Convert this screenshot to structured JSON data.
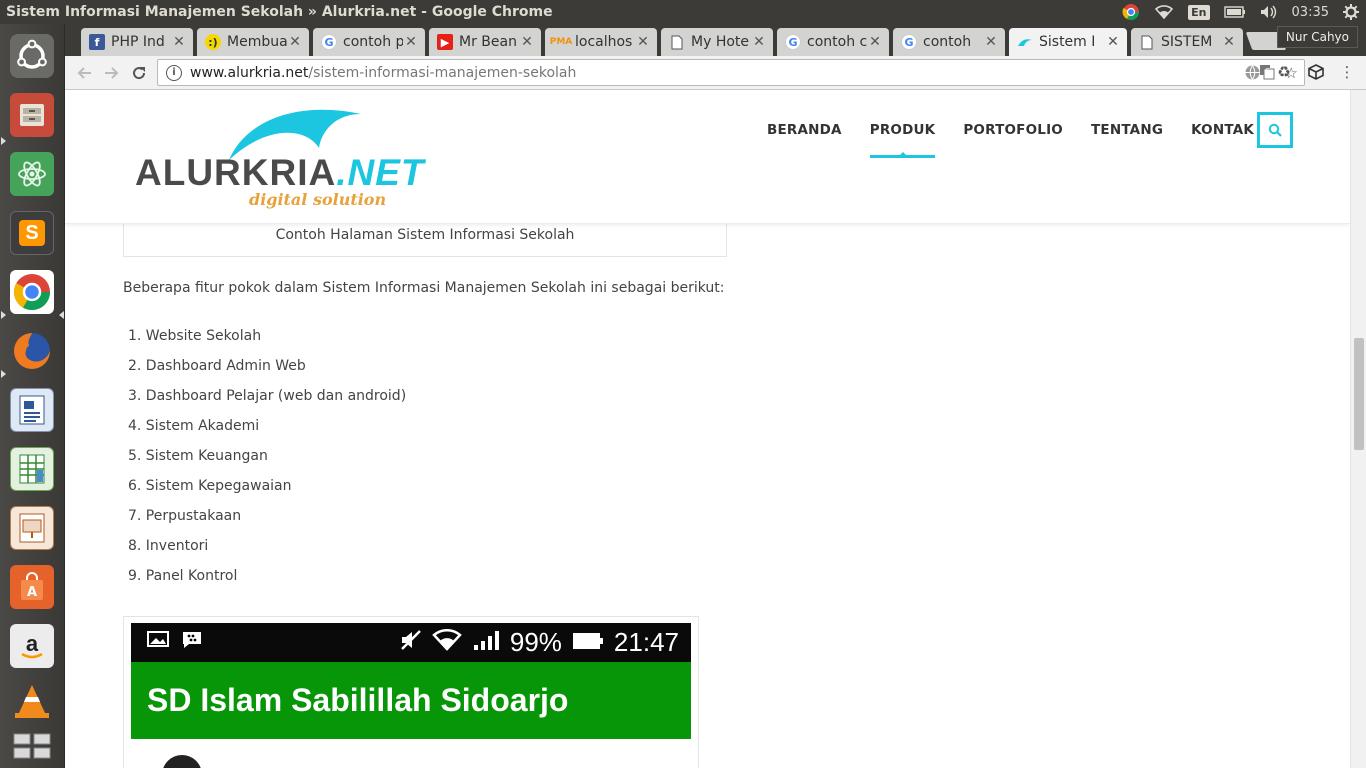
{
  "window": {
    "title": "Sistem Informasi Manajemen Sekolah » Alurkria.net - Google Chrome"
  },
  "tray": {
    "lang": "En",
    "clock": "03:35"
  },
  "launcher": {
    "items": [
      "ubuntu-dash",
      "files",
      "atom",
      "sublime-text",
      "chrome",
      "firefox",
      "libreoffice-writer",
      "libreoffice-calc",
      "libreoffice-impress",
      "software-center",
      "amazon",
      "vlc",
      "workspace-switcher"
    ]
  },
  "tabs": [
    {
      "label": "PHP Ind",
      "icon": "facebook-icon",
      "color": "#3b5998"
    },
    {
      "label": "Membua",
      "icon": "emoji-icon",
      "color": "#f5d800"
    },
    {
      "label": "contoh p",
      "icon": "google-icon",
      "color": "#4285f4"
    },
    {
      "label": "Mr Bean",
      "icon": "youtube-icon",
      "color": "#e62117"
    },
    {
      "label": "localhos",
      "icon": "phpmyadmin-icon",
      "color": "#f29111"
    },
    {
      "label": "My Hote",
      "icon": "page-icon",
      "color": "#888888"
    },
    {
      "label": "contoh c",
      "icon": "google-icon",
      "color": "#4285f4"
    },
    {
      "label": "contoh",
      "icon": "google-icon",
      "color": "#4285f4"
    },
    {
      "label": "Sistem I",
      "icon": "alurkria-icon",
      "color": "#1cc6e0"
    },
    {
      "label": "SISTEM",
      "icon": "page-icon",
      "color": "#888888"
    }
  ],
  "user": {
    "name": "Nur Cahyo"
  },
  "address": {
    "host": "www.alurkria.net",
    "path": "/sistem-informasi-manajemen-sekolah"
  },
  "site": {
    "logo_main": "ALURKRIA",
    "logo_net": ".NET",
    "logo_tagline": "digital solution",
    "accent": "#1cc6e0",
    "nav": [
      "BERANDA",
      "PRODUK",
      "PORTOFOLIO",
      "TENTANG",
      "KONTAK"
    ],
    "active_nav": "PRODUK"
  },
  "article": {
    "caption": "Contoh Halaman Sistem Informasi Sekolah",
    "intro": "Beberapa fitur pokok dalam Sistem Informasi Manajemen Sekolah ini sebagai berikut:",
    "features": [
      "1. Website Sekolah",
      "2. Dashboard Admin Web",
      "3. Dashboard Pelajar (web dan android)",
      "4. Sistem Akademi",
      "5. Sistem Keuangan",
      "6. Sistem Kepegawaian",
      "7. Perpustakaan",
      "8. Inventori",
      "9. Panel Kontrol"
    ],
    "phone": {
      "battery": "99%",
      "time": "21:47",
      "app_title": "SD Islam Sabilillah Sidoarjo"
    }
  }
}
